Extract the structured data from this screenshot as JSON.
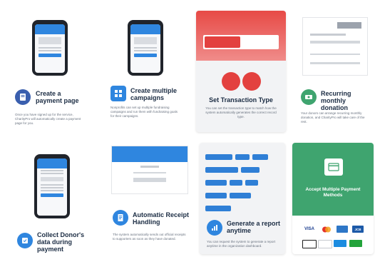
{
  "features": {
    "payment_page": {
      "title": "Create a payment page",
      "desc": "Once you have signed up for the service, CharityPro will automatically create a payment page for you."
    },
    "campaigns": {
      "title": "Create multiple campaigns",
      "desc": "Nonprofits can set up multiple fundraising campaigns and run them with fundraising goals for their campaigns."
    },
    "transaction_type": {
      "title": "Set Transaction Type",
      "desc": "You can set the transaction type to match how the system automatically generates the correct record type."
    },
    "recurring": {
      "title": "Recurring monthly donation",
      "desc": "Your donors can arrange recurring monthly donation, and CharityPro will take care of the rest."
    },
    "donor_data": {
      "title": "Collect Donor's data during payment"
    },
    "receipt": {
      "title": "Automatic Receipt Handling",
      "desc": "The system automatically sends out official receipts to supporters as soon as they have donated."
    },
    "report": {
      "title": "Generate a report anytime",
      "desc": "You can request the system to generate a report anytime in the organization dashboard."
    },
    "methods": {
      "title": "Accept Multiple Payment Methods"
    }
  },
  "payment_logos": [
    "VISA",
    "Mastercard",
    "AMEX",
    "JCB",
    "Apple Pay",
    "G Pay",
    "Alipay",
    "WeChat Pay"
  ],
  "colors": {
    "accent_blue": "#2f86df",
    "header_red": "#e3413f",
    "methods_green": "#3fa46f"
  }
}
